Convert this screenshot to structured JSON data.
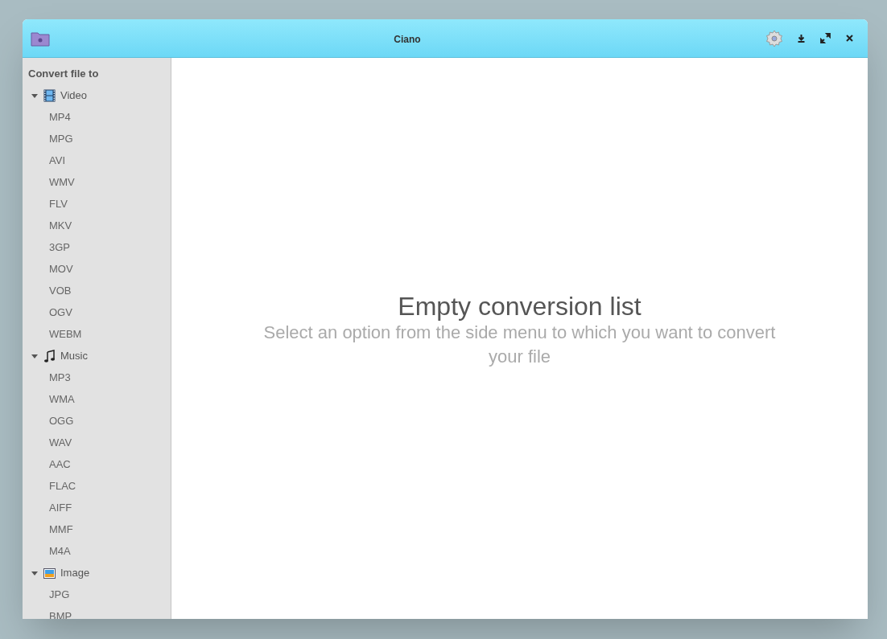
{
  "window": {
    "title": "Ciano"
  },
  "sidebar": {
    "heading": "Convert file to",
    "groups": [
      {
        "kind": "video",
        "label": "Video",
        "expanded": true,
        "items": [
          "MP4",
          "MPG",
          "AVI",
          "WMV",
          "FLV",
          "MKV",
          "3GP",
          "MOV",
          "VOB",
          "OGV",
          "WEBM"
        ]
      },
      {
        "kind": "music",
        "label": "Music",
        "expanded": true,
        "items": [
          "MP3",
          "WMA",
          "OGG",
          "WAV",
          "AAC",
          "FLAC",
          "AIFF",
          "MMF",
          "M4A"
        ]
      },
      {
        "kind": "image",
        "label": "Image",
        "expanded": true,
        "items": [
          "JPG",
          "BMP"
        ]
      }
    ]
  },
  "empty_state": {
    "title": "Empty conversion list",
    "message": "Select an option from the side menu to which you want to convert your file"
  }
}
